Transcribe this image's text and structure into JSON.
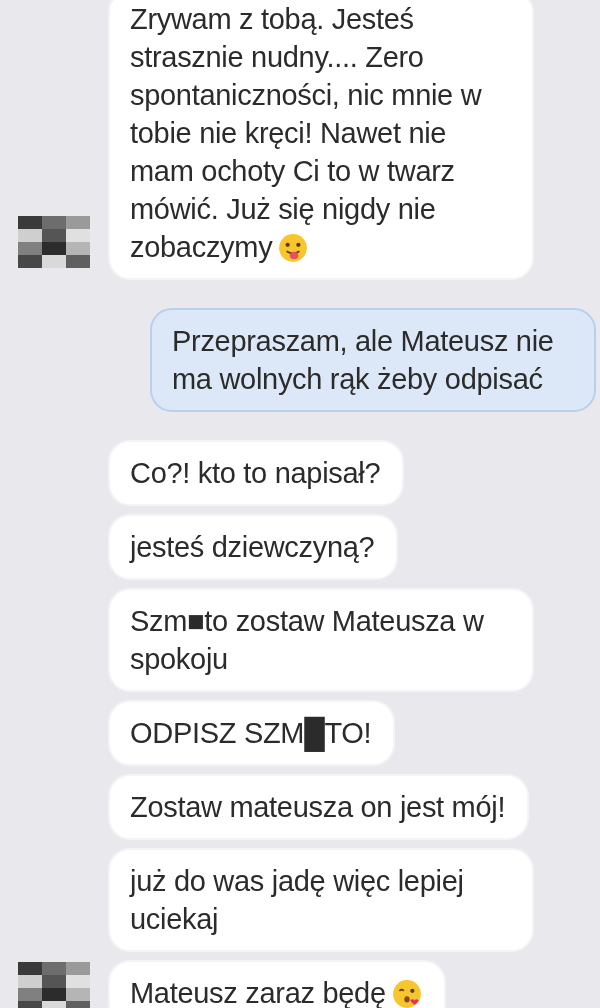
{
  "messages": [
    {
      "kind": "incoming",
      "text": "Zrywam z tobą. Jesteś strasznie nudny.... Zero spontaniczności, nic mnie w tobie nie kręci! Nawet nie mam ochoty Ci to w twarz mówić. Już się nigdy nie zobaczymy",
      "emoji": {
        "kind": "tongue"
      },
      "avatar": true
    },
    {
      "kind": "outgoing",
      "text": "Przepraszam, ale Mateusz nie ma wolnych rąk żeby odpisać",
      "avatar": false
    },
    {
      "kind": "incoming",
      "text": "Co?! kto to napisał?",
      "avatar": false
    },
    {
      "kind": "incoming",
      "text": "jesteś dziewczyną?",
      "avatar": false
    },
    {
      "kind": "incoming",
      "text": "Szm■to zostaw Mateusza w spokoju",
      "avatar": false
    },
    {
      "kind": "incoming",
      "text": "ODPISZ SZM█TO!",
      "avatar": false
    },
    {
      "kind": "incoming",
      "text": "Zostaw mateusza on jest mój!",
      "avatar": false
    },
    {
      "kind": "incoming",
      "text": "już do was jadę więc lepiej uciekaj",
      "avatar": false
    },
    {
      "kind": "incoming",
      "text": "Mateusz zaraz będę",
      "emoji": {
        "kind": "kiss"
      },
      "avatar": true
    }
  ]
}
